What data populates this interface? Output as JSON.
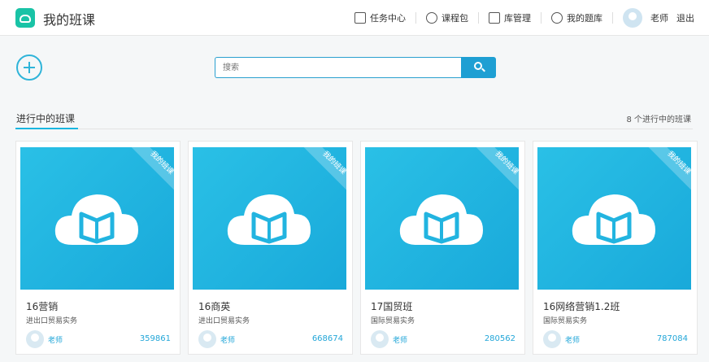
{
  "header": {
    "title": "我的班课",
    "nav": [
      {
        "label": "任务中心",
        "icon": "task-icon"
      },
      {
        "label": "课程包",
        "icon": "package-icon"
      },
      {
        "label": "库管理",
        "icon": "library-icon"
      },
      {
        "label": "我的题库",
        "icon": "question-bank-icon"
      }
    ],
    "user_name": "老师",
    "logout_label": "退出"
  },
  "search": {
    "placeholder": "搜索"
  },
  "section": {
    "title": "进行中的班课",
    "count_label": "8 个进行中的班课"
  },
  "colors": {
    "accent": "#1e9fd3",
    "cover": "#22b4e0",
    "logo": "#19c3a6"
  },
  "cards": [
    {
      "ribbon": "我的班课",
      "name": "16营销",
      "subject": "进出口贸易实务",
      "teacher": "老师",
      "code": "359861"
    },
    {
      "ribbon": "我的班课",
      "name": "16商英",
      "subject": "进出口贸易实务",
      "teacher": "老师",
      "code": "668674"
    },
    {
      "ribbon": "我的班课",
      "name": "17国贸班",
      "subject": "国际贸易实务",
      "teacher": "老师",
      "code": "280562"
    },
    {
      "ribbon": "我的班课",
      "name": "16网络营销1.2班",
      "subject": "国际贸易实务",
      "teacher": "老师",
      "code": "787084"
    }
  ]
}
